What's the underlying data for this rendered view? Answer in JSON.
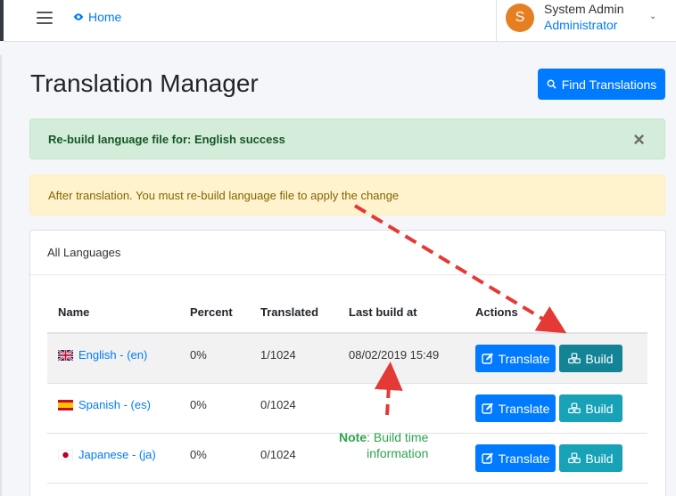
{
  "topbar": {
    "home_label": "Home",
    "user_name": "System Admin",
    "user_role": "Administrator",
    "avatar_initial": "S"
  },
  "page": {
    "title": "Translation Manager",
    "find_button": "Find Translations"
  },
  "alerts": {
    "success": "Re-build language file for: English success",
    "close": "×",
    "warning": "After translation. You must re-build language file to apply the change"
  },
  "card": {
    "header": "All Languages"
  },
  "table": {
    "headers": [
      "Name",
      "Percent",
      "Translated",
      "Last build at",
      "Actions"
    ],
    "rows": [
      {
        "name": "English - (en)",
        "percent": "0%",
        "translated": "1/1024",
        "last_build": "08/02/2019 15:49",
        "flag": "flag-uk-icon"
      },
      {
        "name": "Spanish - (es)",
        "percent": "0%",
        "translated": "0/1024",
        "last_build": "",
        "flag": "flag-spain-icon"
      },
      {
        "name": "Japanese - (ja)",
        "percent": "0%",
        "translated": "0/1024",
        "last_build": "",
        "flag": "flag-japan-icon"
      }
    ],
    "translate_label": "Translate",
    "build_label": "Build"
  },
  "annotation": {
    "note_bold": "Note",
    "note_rest": ": Build time",
    "note_line2": "information",
    "arrow_color": "#e53935"
  },
  "colors": {
    "primary": "#007bff",
    "info": "#17a2b8",
    "success_bg": "#d4edda",
    "warning_bg": "#fff3cd",
    "avatar": "#e67e22",
    "note": "#2ea34d"
  }
}
